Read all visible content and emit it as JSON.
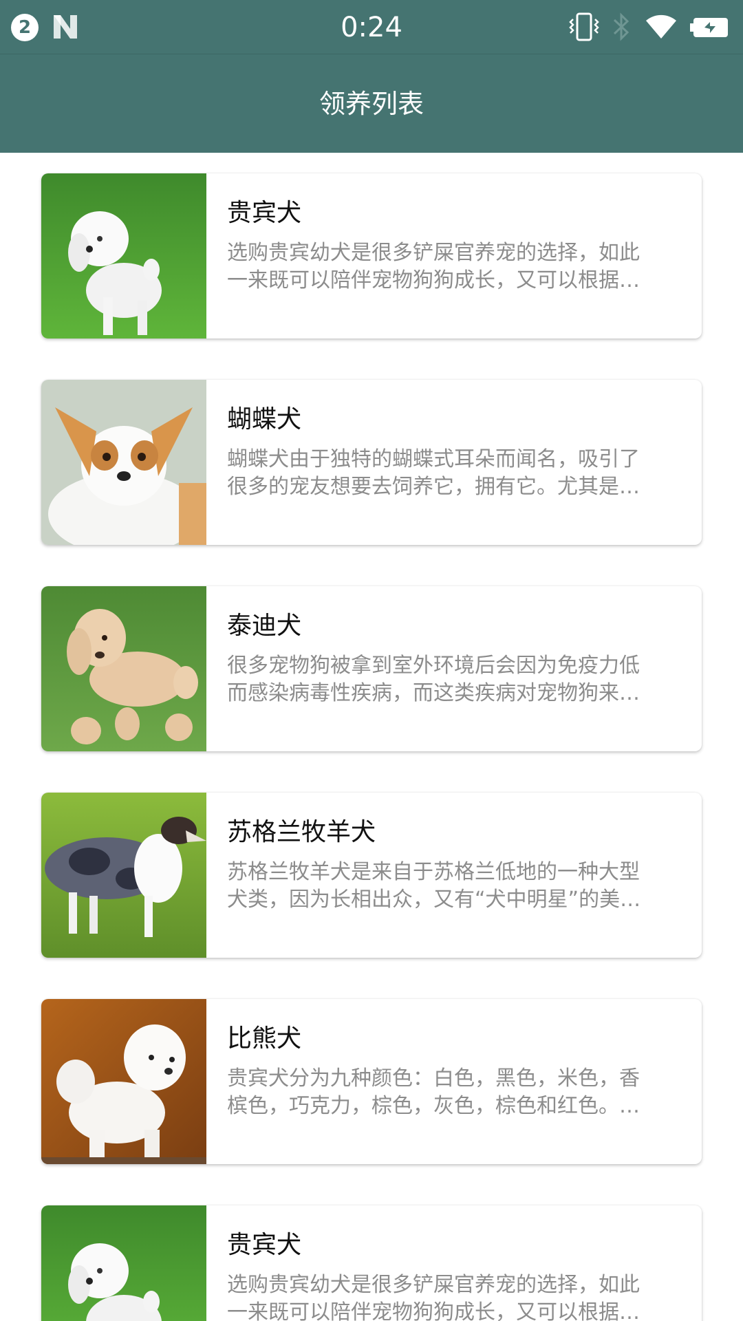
{
  "status_bar": {
    "notification_count": "2",
    "time": "0:24",
    "icons": [
      "notification-badge-icon",
      "n-logo-icon",
      "vibrate-icon",
      "bluetooth-icon",
      "wifi-icon",
      "battery-icon"
    ]
  },
  "app_bar": {
    "title": "领养列表"
  },
  "colors": {
    "primary": "#457471",
    "card_title": "#111111",
    "card_desc": "#8c8c8c"
  },
  "pets": [
    {
      "name": "贵宾犬",
      "desc_line1": "选购贵宾幼犬是很多铲屎官养宠的选择，如此",
      "desc_line2": "一来既可以陪伴宠物狗狗成长，又可以根据…",
      "image": "white-poodle-on-grass"
    },
    {
      "name": "蝴蝶犬",
      "desc_line1": "蝴蝶犬由于独特的蝴蝶式耳朵而闻名，吸引了",
      "desc_line2": "很多的宠友想要去饲养它，拥有它。尤其是…",
      "image": "papillon-portrait"
    },
    {
      "name": "泰迪犬",
      "desc_line1": "很多宠物狗被拿到室外环境后会因为免疫力低",
      "desc_line2": "而感染病毒性疾病，而这类疾病对宠物狗来…",
      "image": "apricot-poodle-on-grass"
    },
    {
      "name": "苏格兰牧羊犬",
      "desc_line1": "苏格兰牧羊犬是来自于苏格兰低地的一种大型",
      "desc_line2": "犬类，因为长相出众，又有“犬中明星”的美…",
      "image": "blue-merle-collie-on-grass"
    },
    {
      "name": "比熊犬",
      "desc_line1": "贵宾犬分为九种颜色：白色，黑色，米色，香",
      "desc_line2": "槟色，巧克力，棕色，灰色，棕色和红色。…",
      "image": "white-bichon-autumn-background"
    },
    {
      "name": "贵宾犬",
      "desc_line1": "选购贵宾幼犬是很多铲屎官养宠的选择，如此",
      "desc_line2": "一来既可以陪伴宠物狗狗成长，又可以根据…",
      "image": "white-poodle-on-grass"
    }
  ]
}
